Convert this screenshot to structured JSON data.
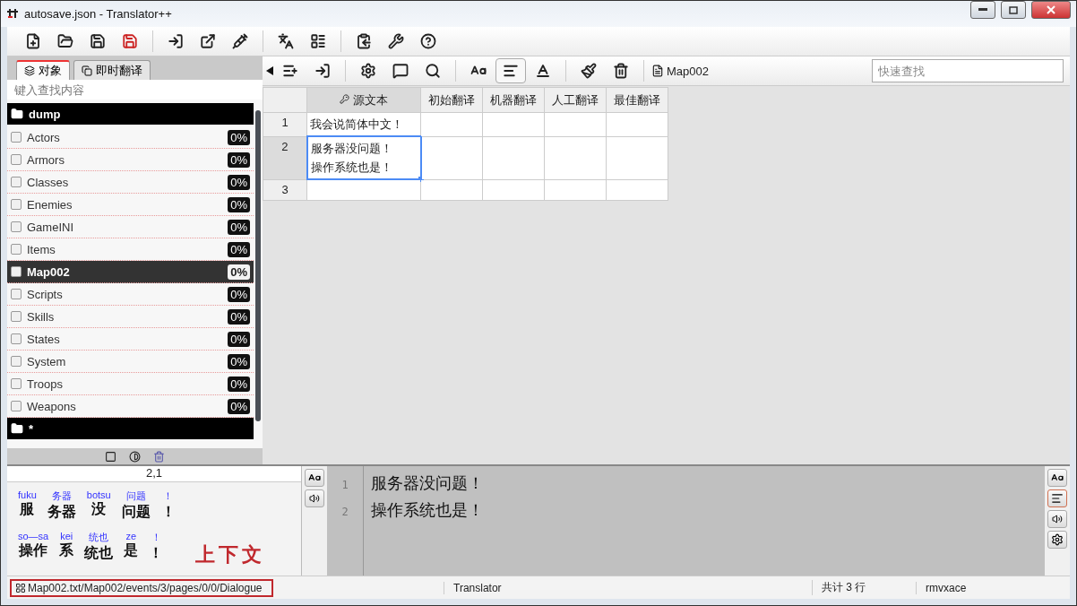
{
  "window": {
    "title": "autosave.json - Translator++"
  },
  "left_panel": {
    "tabs": [
      {
        "label": "对象",
        "selected": true
      },
      {
        "label": "即时翻译",
        "selected": false
      }
    ],
    "search": {
      "placeholder": "键入查找内容"
    },
    "tree": [
      {
        "label": "dump",
        "children": [
          {
            "label": "Actors",
            "progress": "0%",
            "checked": false,
            "selected": false
          },
          {
            "label": "Armors",
            "progress": "0%",
            "checked": false,
            "selected": false
          },
          {
            "label": "Classes",
            "progress": "0%",
            "checked": false,
            "selected": false
          },
          {
            "label": "Enemies",
            "progress": "0%",
            "checked": false,
            "selected": false
          },
          {
            "label": "GameINI",
            "progress": "0%",
            "checked": false,
            "selected": false
          },
          {
            "label": "Items",
            "progress": "0%",
            "checked": false,
            "selected": false
          },
          {
            "label": "Map002",
            "progress": "0%",
            "checked": false,
            "selected": true
          },
          {
            "label": "Scripts",
            "progress": "0%",
            "checked": false,
            "selected": false
          },
          {
            "label": "Skills",
            "progress": "0%",
            "checked": false,
            "selected": false
          },
          {
            "label": "States",
            "progress": "0%",
            "checked": false,
            "selected": false
          },
          {
            "label": "System",
            "progress": "0%",
            "checked": false,
            "selected": false
          },
          {
            "label": "Troops",
            "progress": "0%",
            "checked": false,
            "selected": false
          },
          {
            "label": "Weapons",
            "progress": "0%",
            "checked": false,
            "selected": false
          }
        ]
      },
      {
        "label": "*"
      }
    ]
  },
  "editor_toolbar": {
    "file_label": "Map002",
    "quick_search": {
      "placeholder": "快速查找"
    }
  },
  "table": {
    "columns": [
      "源文本",
      "初始翻译",
      "机器翻译",
      "人工翻译",
      "最佳翻译"
    ],
    "rows": [
      {
        "number": "1",
        "source": [
          "我会说简体中文！"
        ],
        "selected": false
      },
      {
        "number": "2",
        "source": [
          "服务器没问题！",
          "操作系统也是！"
        ],
        "selected": true
      },
      {
        "number": "3",
        "selected": false
      }
    ]
  },
  "context": {
    "cursor": "2,1",
    "ruby_lines": [
      [
        {
          "ruby": "fuku",
          "base": "服"
        },
        {
          "ruby": "务器",
          "base": "务器"
        },
        {
          "ruby": "botsu",
          "base": "没"
        },
        {
          "ruby": "问题",
          "base": "问题"
        },
        {
          "ruby": "！",
          "base": "！"
        }
      ],
      [
        {
          "ruby": "so—sa",
          "base": "操作"
        },
        {
          "ruby": "kei",
          "base": "系"
        },
        {
          "ruby": "统也",
          "base": "统也"
        },
        {
          "ruby": "ze",
          "base": "是"
        },
        {
          "ruby": "！",
          "base": "！"
        }
      ]
    ],
    "annotation": "上下文"
  },
  "editor": {
    "lines": [
      {
        "number": "1",
        "text": "服务器没问题！"
      },
      {
        "number": "2",
        "text": "操作系统也是！"
      }
    ]
  },
  "status_bar": {
    "path": "Map002.txt/Map002/events/3/pages/0/0/Dialogue",
    "mode": "Translator",
    "count": "共计 3 行",
    "engine": "rmvxace"
  }
}
